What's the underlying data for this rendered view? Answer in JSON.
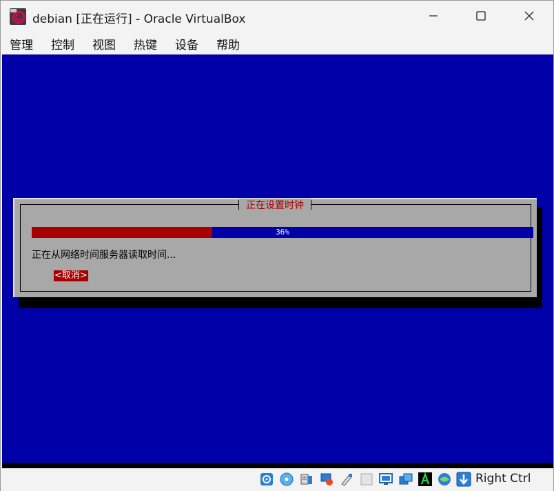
{
  "window": {
    "title": "debian [正在运行] - Oracle VirtualBox"
  },
  "menu": {
    "items": [
      {
        "label": "管理"
      },
      {
        "label": "控制"
      },
      {
        "label": "视图"
      },
      {
        "label": "热键"
      },
      {
        "label": "设备"
      },
      {
        "label": "帮助"
      }
    ]
  },
  "installer": {
    "dialog_title": "正在设置时钟",
    "progress_percent": 36,
    "progress_label": "36%",
    "status_message": "正在从网络时间服务器读取时间...",
    "cancel_label": "<取消>"
  },
  "statusbar": {
    "host_key": "Right Ctrl",
    "icons": [
      "hard-disk-icon",
      "optical-drive-icon",
      "audio-icon",
      "network-icon",
      "usb-icon",
      "shared-folders-icon",
      "display-icon",
      "capture-icon",
      "mouse-integration-icon",
      "guest-additions-icon",
      "host-key-icon"
    ]
  },
  "colors": {
    "vm_background": "#0000a8",
    "dialog_background": "#a8a8a8",
    "accent_red": "#a80000"
  }
}
